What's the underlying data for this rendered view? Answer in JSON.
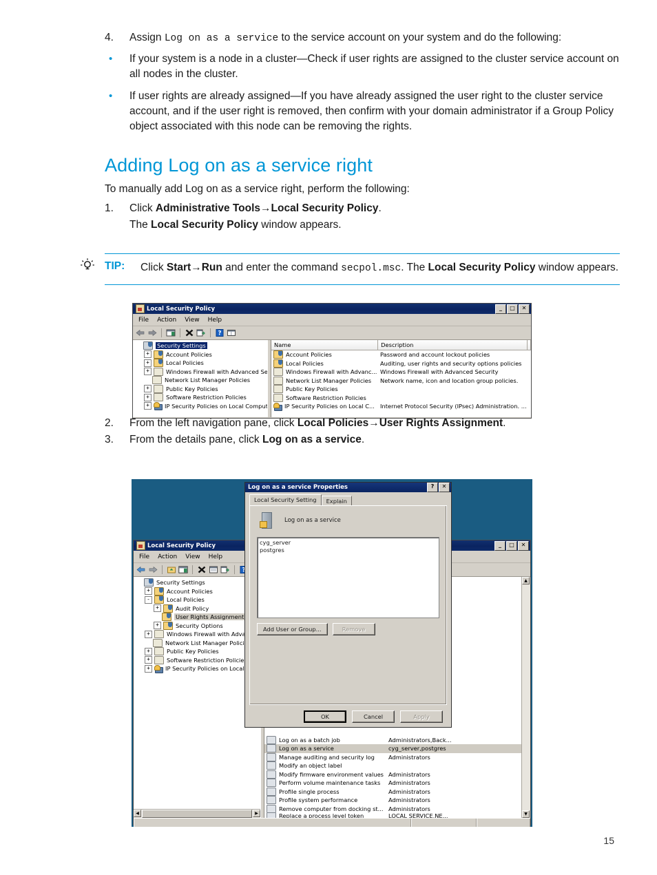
{
  "doc": {
    "step4": {
      "num": "4.",
      "pre": "Assign ",
      "code": "Log on as a service",
      "post": " to the service account on your system and do the following:"
    },
    "bullets": [
      "If your system is a node in a cluster—Check if user rights are assigned to the cluster service account on all nodes in the cluster.",
      "If user rights are already assigned—If you have already assigned the user right to the cluster service account, and if the user right is removed, then confirm with your domain administrator if a Group Policy object associated with this node can be removing the rights."
    ],
    "section_title": "Adding Log on as a service right",
    "lead": "To manually add Log on as a service right, perform the following:",
    "step1": {
      "num": "1.",
      "pre": "Click ",
      "bold1": "Administrative Tools→Local Security Policy",
      "post": ".",
      "sub_pre": "The ",
      "sub_bold": "Local Security Policy",
      "sub_post": " window appears."
    },
    "tip": {
      "icon": "lightbulb-icon",
      "label": "TIP:",
      "pre": "Click ",
      "bold1": "Start→Run",
      "mid": " and enter the command ",
      "code": "secpol.msc",
      "mid2": ". The ",
      "bold2": "Local Security Policy",
      "post": " window appears."
    },
    "step2": {
      "num": "2.",
      "pre": "From the left navigation pane, click ",
      "bold": "Local Policies→User Rights Assignment",
      "post": "."
    },
    "step3": {
      "num": "3.",
      "pre": "From the details pane, click ",
      "bold": "Log on as a service",
      "post": "."
    },
    "page_number": "15"
  },
  "colors": {
    "accent_blue": "#0096d6",
    "teal_background": "#1a5c82",
    "titlebar_navy": "#0a2461",
    "window_face": "#d4d0c8"
  },
  "screenshot1": {
    "window_title": "Local Security Policy",
    "menus": [
      "File",
      "Action",
      "View",
      "Help"
    ],
    "titlebar_buttons": [
      "_",
      "□",
      "✕"
    ],
    "toolbar_icons": [
      "back-arrow-icon",
      "forward-arrow-icon",
      "show-hide-tree-icon",
      "delete-icon",
      "export-list-icon",
      "help-icon",
      "view-icon"
    ],
    "tree": [
      {
        "label": "Security Settings",
        "expander": "",
        "indent": 0,
        "icon": "security-settings-icon",
        "selected": true
      },
      {
        "label": "Account Policies",
        "expander": "+",
        "indent": 1,
        "icon": "folder-shield-icon",
        "selected": false
      },
      {
        "label": "Local Policies",
        "expander": "+",
        "indent": 1,
        "icon": "folder-shield-icon",
        "selected": false
      },
      {
        "label": "Windows Firewall with Advanced Security",
        "expander": "+",
        "indent": 1,
        "icon": "folder-icon",
        "selected": false
      },
      {
        "label": "Network List Manager Policies",
        "expander": "",
        "indent": 1,
        "icon": "folder-icon",
        "selected": false
      },
      {
        "label": "Public Key Policies",
        "expander": "+",
        "indent": 1,
        "icon": "folder-icon",
        "selected": false
      },
      {
        "label": "Software Restriction Policies",
        "expander": "+",
        "indent": 1,
        "icon": "folder-icon",
        "selected": false
      },
      {
        "label": "IP Security Policies on Local Computer",
        "expander": "+",
        "indent": 1,
        "icon": "ipsec-icon",
        "selected": false
      }
    ],
    "list_columns": [
      "Name",
      "Description"
    ],
    "list_rows": [
      {
        "name": "Account Policies",
        "description": "Password and account lockout policies",
        "icon": "folder-shield-icon"
      },
      {
        "name": "Local Policies",
        "description": "Auditing, user rights and security options policies",
        "icon": "folder-shield-icon"
      },
      {
        "name": "Windows Firewall with Advanc...",
        "description": "Windows Firewall with Advanced Security",
        "icon": "folder-icon"
      },
      {
        "name": "Network List Manager Policies",
        "description": "Network name, icon and location group policies.",
        "icon": "folder-icon"
      },
      {
        "name": "Public Key Policies",
        "description": "",
        "icon": "folder-icon"
      },
      {
        "name": "Software Restriction Policies",
        "description": "",
        "icon": "folder-icon"
      },
      {
        "name": "IP Security Policies on Local C...",
        "description": "Internet Protocol Security (IPsec) Administration. ...",
        "icon": "ipsec-icon"
      }
    ]
  },
  "screenshot2": {
    "lsp_window": {
      "window_title": "Local Security Policy",
      "menus": [
        "File",
        "Action",
        "View",
        "Help"
      ],
      "titlebar_buttons": [
        "_",
        "□",
        "✕"
      ],
      "toolbar_icons": [
        "back-arrow-icon",
        "forward-arrow-icon",
        "up-folder-icon",
        "show-hide-tree-icon",
        "delete-icon",
        "properties-icon",
        "export-list-icon",
        "help-icon",
        "view-icon"
      ],
      "tree": [
        {
          "label": "Security Settings",
          "expander": "",
          "indent": 0,
          "icon": "security-settings-icon",
          "selected": false
        },
        {
          "label": "Account Policies",
          "expander": "+",
          "indent": 1,
          "icon": "folder-shield-icon",
          "selected": false
        },
        {
          "label": "Local Policies",
          "expander": "-",
          "indent": 1,
          "icon": "folder-shield-icon",
          "selected": false
        },
        {
          "label": "Audit Policy",
          "expander": "+",
          "indent": 2,
          "icon": "folder-shield-icon",
          "selected": false
        },
        {
          "label": "User Rights Assignment",
          "expander": "",
          "indent": 2,
          "icon": "folder-shield-icon",
          "selected": true
        },
        {
          "label": "Security Options",
          "expander": "+",
          "indent": 2,
          "icon": "folder-shield-icon",
          "selected": false
        },
        {
          "label": "Windows Firewall with Advanced Sec...",
          "expander": "+",
          "indent": 1,
          "icon": "folder-icon",
          "selected": false
        },
        {
          "label": "Network List Manager Policies",
          "expander": "",
          "indent": 1,
          "icon": "folder-icon",
          "selected": false
        },
        {
          "label": "Public Key Policies",
          "expander": "+",
          "indent": 1,
          "icon": "folder-icon",
          "selected": false
        },
        {
          "label": "Software Restriction Policies",
          "expander": "+",
          "indent": 1,
          "icon": "folder-icon",
          "selected": false
        },
        {
          "label": "IP Security Policies on Local Computer",
          "expander": "+",
          "indent": 1,
          "icon": "ipsec-icon",
          "selected": false
        }
      ],
      "policy_rows": [
        {
          "name": "Log on as a batch job",
          "setting": "Administrators,Back...",
          "selected": false
        },
        {
          "name": "Log on as a service",
          "setting": "cyg_server,postgres",
          "selected": true
        },
        {
          "name": "Manage auditing and security log",
          "setting": "Administrators",
          "selected": false
        },
        {
          "name": "Modify an object label",
          "setting": "",
          "selected": false
        },
        {
          "name": "Modify firmware environment values",
          "setting": "Administrators",
          "selected": false
        },
        {
          "name": "Perform volume maintenance tasks",
          "setting": "Administrators",
          "selected": false
        },
        {
          "name": "Profile single process",
          "setting": "Administrators",
          "selected": false
        },
        {
          "name": "Profile system performance",
          "setting": "Administrators",
          "selected": false
        },
        {
          "name": "Remove computer from docking st...",
          "setting": "Administrators",
          "selected": false
        },
        {
          "name": "Replace a process level token",
          "setting": "LOCAL SERVICE,NE...",
          "selected": false
        }
      ]
    },
    "properties_dialog": {
      "title": "Log on as a service Properties",
      "titlebar_buttons": [
        "?",
        "✕"
      ],
      "tabs": [
        {
          "label": "Local Security Setting",
          "active": true
        },
        {
          "label": "Explain",
          "active": false
        }
      ],
      "policy_name": "Log on as a service",
      "users": [
        "cyg_server",
        "postgres"
      ],
      "buttons": {
        "add": "Add User or Group...",
        "remove": "Remove",
        "ok": "OK",
        "cancel": "Cancel",
        "apply": "Apply"
      }
    }
  }
}
